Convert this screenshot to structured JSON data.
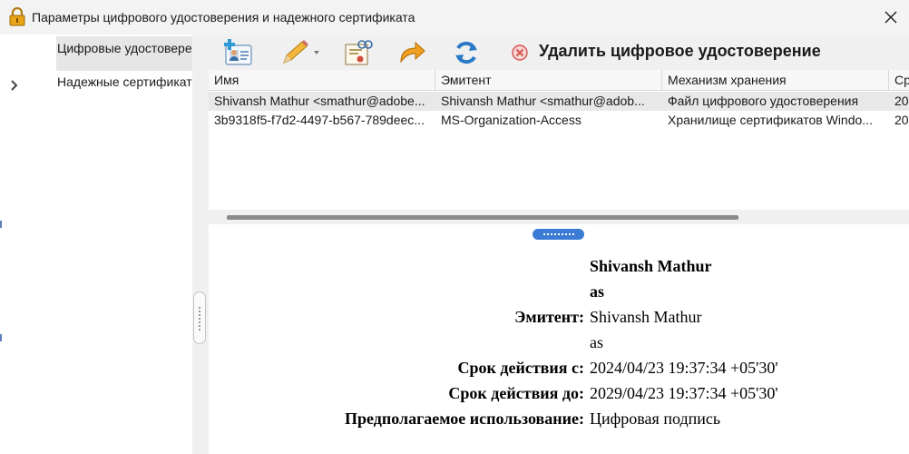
{
  "window": {
    "title": "Параметры цифрового удостоверения и надежного сертификата"
  },
  "sidebar": {
    "items": [
      {
        "label": "Цифровые удостоверения"
      },
      {
        "label": "Надежные сертификаты"
      }
    ]
  },
  "toolbar": {
    "delete_label": "Удалить цифровое удостоверение"
  },
  "table": {
    "columns": [
      "Имя",
      "Эмитент",
      "Механизм хранения",
      "Ср"
    ],
    "rows": [
      [
        "Shivansh Mathur <smathur@adobe...",
        "Shivansh Mathur <smathur@adob...",
        "Файл цифрового удостоверения",
        "20"
      ],
      [
        "3b9318f5-f7d2-4497-b567-789deec...",
        "MS-Organization-Access",
        "Хранилище сертификатов Windo...",
        "20"
      ]
    ]
  },
  "details": {
    "name": "Shivansh Mathur",
    "name_sub": "as",
    "issuer_label": "Эмитент:",
    "issuer_value": "Shivansh Mathur",
    "issuer_sub": "as",
    "valid_from_label": "Срок действия с:",
    "valid_from_value": "2024/04/23 19:37:34 +05'30'",
    "valid_to_label": "Срок действия до:",
    "valid_to_value": "2029/04/23 19:37:34 +05'30'",
    "usage_label": "Предполагаемое использование:",
    "usage_value": "Цифровая подпись"
  },
  "colors": {
    "accent": "#3a7bd5",
    "delete_red": "#d9534f"
  }
}
